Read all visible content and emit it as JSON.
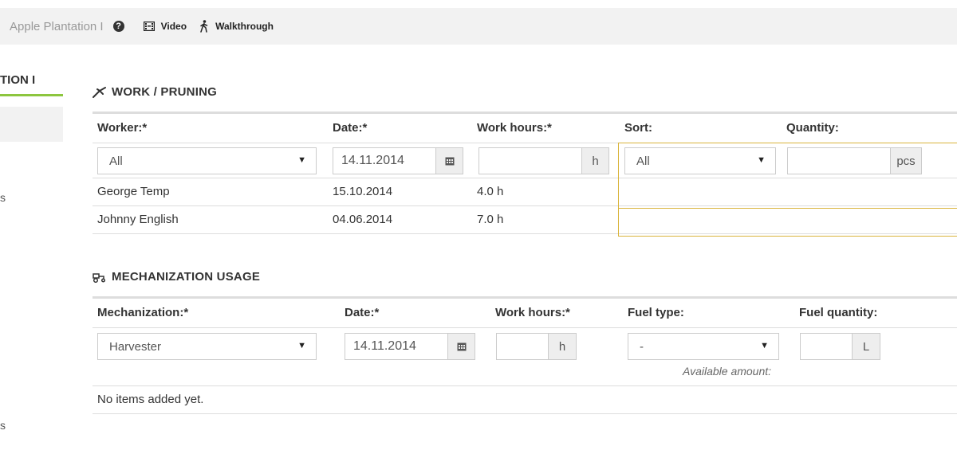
{
  "topbar": {
    "title": "Apple Plantation I",
    "video_label": "Video",
    "walkthrough_label": "Walkthrough"
  },
  "sidebar": {
    "title_fragment": "TION I",
    "item_fragment_1": "s",
    "item_fragment_2": "s"
  },
  "work": {
    "title": "WORK / PRUNING",
    "headers": {
      "worker": "Worker:*",
      "date": "Date:*",
      "hours": "Work hours:*",
      "sort": "Sort:",
      "quantity": "Quantity:"
    },
    "inputs": {
      "worker": "All",
      "date": "14.11.2014",
      "hours": "",
      "hours_unit": "h",
      "sort": "All",
      "quantity": "",
      "quantity_unit": "pcs"
    },
    "rows": [
      {
        "worker": "George Temp",
        "date": "15.10.2014",
        "hours": "4.0 h"
      },
      {
        "worker": "Johnny English",
        "date": "04.06.2014",
        "hours": "7.0 h"
      }
    ]
  },
  "mech": {
    "title": "MECHANIZATION USAGE",
    "headers": {
      "mechanization": "Mechanization:*",
      "date": "Date:*",
      "hours": "Work hours:*",
      "fuel_type": "Fuel type:",
      "fuel_quantity": "Fuel quantity:"
    },
    "inputs": {
      "mechanization": "Harvester",
      "date": "14.11.2014",
      "hours": "",
      "hours_unit": "h",
      "fuel_type": "-",
      "fuel_quantity": "",
      "fuel_unit": "L"
    },
    "available_label": "Available amount:",
    "empty_text": "No items added yet."
  },
  "colors": {
    "accent_green": "#8dc63f",
    "gold_line": "#d9b43c",
    "topbar_bg": "#f2f2f2"
  },
  "icons": [
    "help-icon",
    "film-icon",
    "walk-icon",
    "pruning-icon",
    "tractor-icon",
    "calendar-icon",
    "caret-down-icon"
  ]
}
